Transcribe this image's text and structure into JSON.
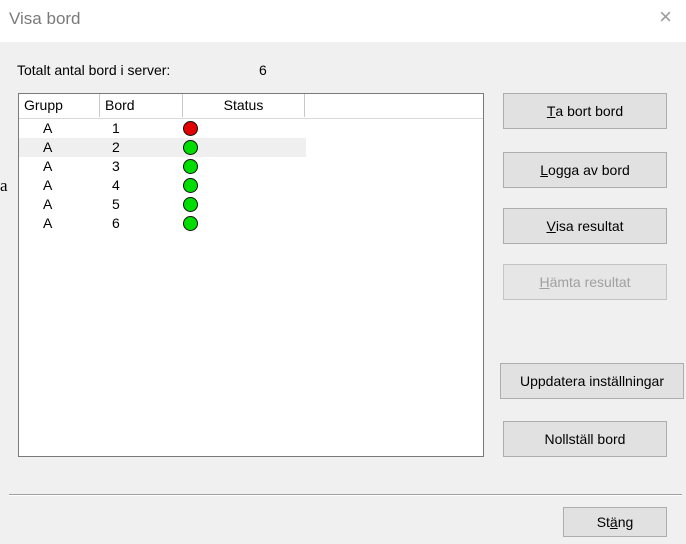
{
  "window": {
    "title": "Visa bord",
    "close_glyph": "×"
  },
  "summary": {
    "label": "Totalt antal bord i server:",
    "value": "6"
  },
  "table": {
    "headers": {
      "grupp": "Grupp",
      "bord": "Bord",
      "status": "Status"
    },
    "rows": [
      {
        "grupp": "A",
        "bord": "1",
        "status": "red"
      },
      {
        "grupp": "A",
        "bord": "2",
        "status": "green"
      },
      {
        "grupp": "A",
        "bord": "3",
        "status": "green"
      },
      {
        "grupp": "A",
        "bord": "4",
        "status": "green"
      },
      {
        "grupp": "A",
        "bord": "5",
        "status": "green"
      },
      {
        "grupp": "A",
        "bord": "6",
        "status": "green"
      }
    ]
  },
  "buttons": {
    "ta_bort": {
      "mnemonic": "T",
      "rest": "a bort bord"
    },
    "logga_av": {
      "mnemonic": "L",
      "rest": "ogga av bord"
    },
    "visa_resultat": {
      "mnemonic": "V",
      "rest": "isa resultat"
    },
    "hamta_resultat": {
      "mnemonic": "H",
      "rest": "ämta resultat",
      "enabled": false
    },
    "uppdatera": {
      "label": "Uppdatera inställningar"
    },
    "nollstall": {
      "label": "Nollställ bord"
    },
    "stang": {
      "pre": "St",
      "mnemonic": "ä",
      "rest": "ng"
    }
  },
  "stray_char": "a",
  "colors": {
    "status_red": "#e00000",
    "status_green": "#00dd00"
  }
}
